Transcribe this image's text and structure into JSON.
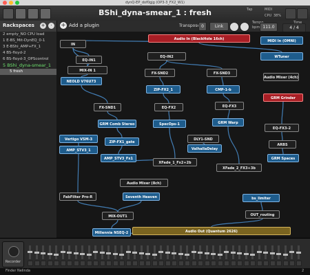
{
  "window": {
    "title": "dynQ-EP_dof0gjg (OP3-3_FX2_W1)"
  },
  "header": {
    "rackspace_title": "BShi_dyna-smear_1 : fresh",
    "tap_label": "Tap",
    "midi_label": "MIDI",
    "cpu_label": "CPU",
    "cpu_value": "38%",
    "learn_label": "Learn",
    "edit_label": "Edit"
  },
  "toolbar": {
    "rackspaces_label": "Rackspaces",
    "add_plugin_label": "Add a plugin",
    "transpose_label": "Transpose",
    "transpose_value": "0",
    "link_label": "Link",
    "tempo_label": "Tempo",
    "tempo_unit": "bpm",
    "tempo_value": "111.0",
    "time_label": "Time",
    "time_value": "4 / 4"
  },
  "rackspaces": [
    {
      "label": "2 empty_NO CPU load",
      "selected": false
    },
    {
      "label": "1 E-BS_Mit-DynEQ_0-1",
      "selected": false
    },
    {
      "label": "3 E-BShi_AMP+FX_1",
      "selected": false
    },
    {
      "label": "4 BS-floyd-2",
      "selected": false
    },
    {
      "label": "6 BS-floyd-3_OPScontrol",
      "selected": false
    },
    {
      "label": "5 BShi_dyna-smear_1",
      "selected": true
    },
    {
      "label": "5  fresh",
      "selected": false,
      "sub": true
    }
  ],
  "nodes": [
    {
      "id": "in",
      "label": "IN",
      "style": "dark"
    },
    {
      "id": "audio-in",
      "label": "Audio In (BlackHole 16ch)",
      "style": "red"
    },
    {
      "id": "midi-in",
      "label": "MIDI In (OMNI)",
      "style": "blue"
    },
    {
      "id": "wtuner",
      "label": "WTuner",
      "style": "blue"
    },
    {
      "id": "eq-in1",
      "label": "EQ-IN1",
      "style": "dark"
    },
    {
      "id": "eq-in2",
      "label": "EQ-IN2",
      "style": "dark"
    },
    {
      "id": "mix-in1",
      "label": "MIX-IN 1",
      "style": "dark"
    },
    {
      "id": "fx-snd2",
      "label": "FX-SND2",
      "style": "dark"
    },
    {
      "id": "fx-snd3",
      "label": "FX-SND3",
      "style": "dark"
    },
    {
      "id": "audio-mixer-4",
      "label": "Audio Mixer (4ch)",
      "style": "dark"
    },
    {
      "id": "neold",
      "label": "NEOLD V76U73",
      "style": "blue"
    },
    {
      "id": "zip-fx2",
      "label": "ZIP-FX2_1",
      "style": "blue"
    },
    {
      "id": "cmp-1b",
      "label": "CMP-1-b",
      "style": "blue"
    },
    {
      "id": "grm-grinder",
      "label": "GRM Grinder",
      "style": "red"
    },
    {
      "id": "eq-fx2",
      "label": "EQ-FX2",
      "style": "dark"
    },
    {
      "id": "eq-fx3",
      "label": "EQ-FX3",
      "style": "dark"
    },
    {
      "id": "fx-snd1",
      "label": "FX-SND1",
      "style": "dark"
    },
    {
      "id": "grm-comb",
      "label": "GRM Comb Stereo",
      "style": "blue"
    },
    {
      "id": "specops",
      "label": "SpecOps-1",
      "style": "blue"
    },
    {
      "id": "grm-warp",
      "label": "GRM Warp",
      "style": "blue"
    },
    {
      "id": "eq-fx3-2",
      "label": "EQ-FX3-2",
      "style": "dark"
    },
    {
      "id": "vertigo",
      "label": "Vertigo VSM-3",
      "style": "blue"
    },
    {
      "id": "zip-fx1",
      "label": "ZIP-FX1_gate",
      "style": "blue"
    },
    {
      "id": "dly1-snd",
      "label": "DLY1-SND",
      "style": "dark"
    },
    {
      "id": "valhalla",
      "label": "ValhallaDelay",
      "style": "blue"
    },
    {
      "id": "arbs",
      "label": "ARBS",
      "style": "dark"
    },
    {
      "id": "amp-stv3",
      "label": "AMP_STV3_1",
      "style": "blue"
    },
    {
      "id": "amp-stv3-fx1",
      "label": "AMP_STV3_Fx1",
      "style": "blue"
    },
    {
      "id": "grm-spaces",
      "label": "GRM Spaces",
      "style": "blue"
    },
    {
      "id": "xfade1",
      "label": "XFade_1_Fx2+2b",
      "style": "dark"
    },
    {
      "id": "xfade2",
      "label": "XFade_2_FX3+3b",
      "style": "dark"
    },
    {
      "id": "audio-mixer-8",
      "label": "Audio Mixer (8ch)",
      "style": "dark"
    },
    {
      "id": "seventh-heaven",
      "label": "Seventh Heaven",
      "style": "blue"
    },
    {
      "id": "fabfilter",
      "label": "FabFilter Pro-R",
      "style": "dark"
    },
    {
      "id": "bs-limiter",
      "label": "bs_limiter",
      "style": "blue"
    },
    {
      "id": "mix-out1",
      "label": "MIX-OUT1",
      "style": "dark"
    },
    {
      "id": "out-routing",
      "label": "OUT_routing",
      "style": "dark"
    },
    {
      "id": "millennia",
      "label": "Millennia NSEQ-2",
      "style": "blue"
    },
    {
      "id": "audio-out",
      "label": "Audio Out (Quantum 2626)",
      "style": "gold"
    }
  ],
  "mixer": {
    "recorder_label": "Recorder"
  },
  "taskbar": {
    "app_label": "Finder Nelinda",
    "count": "2"
  }
}
